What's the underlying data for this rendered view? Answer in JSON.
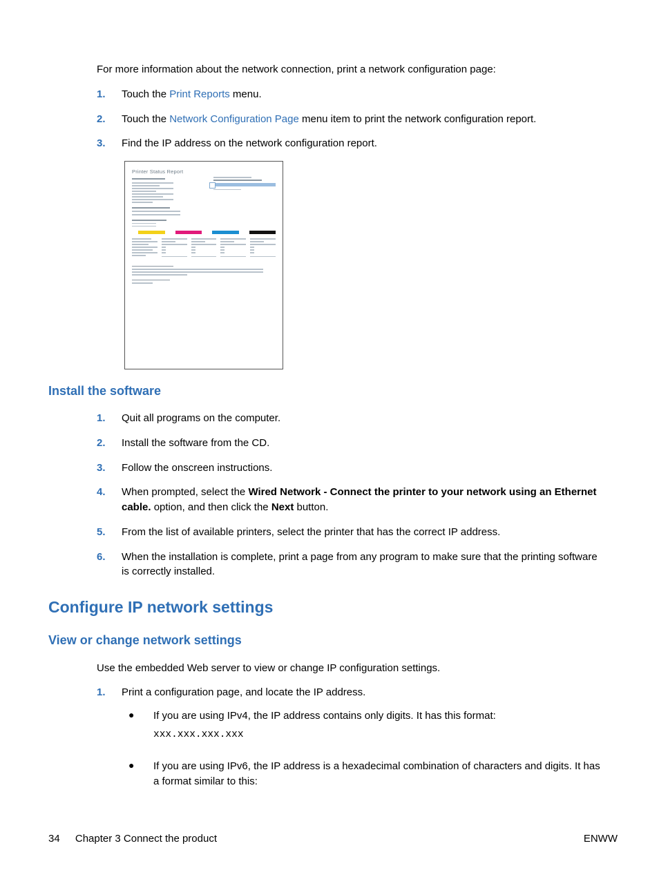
{
  "intro": "For more information about the network connection, print a network configuration page:",
  "steps_top": [
    {
      "num": "1.",
      "pre": "Touch the ",
      "link": "Print Reports",
      "post": " menu."
    },
    {
      "num": "2.",
      "pre": "Touch the ",
      "link": "Network Configuration Page",
      "post": " menu item to print the network configuration report."
    },
    {
      "num": "3.",
      "pre": "Find the IP address on the network configuration report.",
      "link": "",
      "post": ""
    }
  ],
  "report_title": "Printer Status Report",
  "h_install": "Install the software",
  "steps_install": [
    {
      "num": "1.",
      "text": "Quit all programs on the computer."
    },
    {
      "num": "2.",
      "text": "Install the software from the CD."
    },
    {
      "num": "3.",
      "text": "Follow the onscreen instructions."
    },
    {
      "num": "4.",
      "pre": "When prompted, select the ",
      "bold1": "Wired Network - Connect the printer to your network using an Ethernet cable.",
      "mid": " option, and then click the ",
      "bold2": "Next",
      "post": " button."
    },
    {
      "num": "5.",
      "text": "From the list of available printers, select the printer that has the correct IP address."
    },
    {
      "num": "6.",
      "text": "When the installation is complete, print a page from any program to make sure that the printing software is correctly installed."
    }
  ],
  "h_configure": "Configure IP network settings",
  "h_view": "View or change network settings",
  "view_intro": "Use the embedded Web server to view or change IP configuration settings.",
  "view_step1_num": "1.",
  "view_step1_text": "Print a configuration page, and locate the IP address.",
  "bullet_ipv4": "If you are using IPv4, the IP address contains only digits. It has this format:",
  "ipv4_format": "xxx.xxx.xxx.xxx",
  "bullet_ipv6": "If you are using IPv6, the IP address is a hexadecimal combination of characters and digits. It has a format similar to this:",
  "footer": {
    "page": "34",
    "chapter": "Chapter 3   Connect the product",
    "lang": "ENWW"
  }
}
